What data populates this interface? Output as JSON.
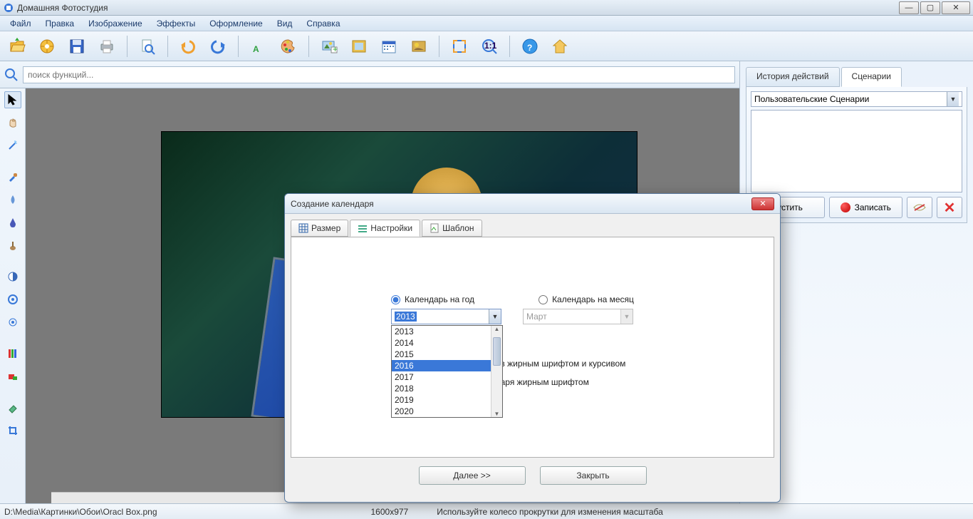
{
  "window": {
    "title": "Домашняя Фотостудия"
  },
  "menu": {
    "items": [
      "Файл",
      "Правка",
      "Изображение",
      "Эффекты",
      "Оформление",
      "Вид",
      "Справка"
    ]
  },
  "toolbar": {
    "icons": [
      "open",
      "wheel",
      "save",
      "print",
      "zoom-doc",
      "undo",
      "redo",
      "text",
      "palette",
      "image-add",
      "image",
      "calendar",
      "sun-frame",
      "fullscreen",
      "1to1",
      "help",
      "home"
    ]
  },
  "search": {
    "placeholder": "поиск функций..."
  },
  "tools": {
    "list": [
      "pointer",
      "hand",
      "wand",
      "eyedropper",
      "blur",
      "smudge",
      "clone",
      "contrast",
      "sharpen",
      "dodge",
      "levels",
      "redeye",
      "eraser",
      "crop"
    ]
  },
  "right": {
    "tabs": {
      "history": "История действий",
      "scenarios": "Сценарии"
    },
    "select": "Пользовательские Сценарии",
    "btn_run": "пустить",
    "btn_record": "Записать"
  },
  "dialog": {
    "title": "Создание календаря",
    "tabs": {
      "size": "Размер",
      "settings": "Настройки",
      "template": "Шаблон"
    },
    "radio_year": "Календарь на год",
    "radio_month": "Календарь на месяц",
    "year_value": "2013",
    "month_value": "Март",
    "year_options": [
      "2013",
      "2014",
      "2015",
      "2016",
      "2017",
      "2018",
      "2019",
      "2020"
    ],
    "year_highlight": "2016",
    "check_bolditalic_tail": "цев жирным шрифтом и курсивом",
    "check_bold_tail": "ндаря жирным шрифтом",
    "btn_next": "Далее >>",
    "btn_close": "Закрыть"
  },
  "status": {
    "path": "D:\\Media\\Картинки\\Обои\\Oracl Box.png",
    "dims": "1600x977",
    "hint": "Используйте колесо прокрутки для изменения масштаба"
  }
}
